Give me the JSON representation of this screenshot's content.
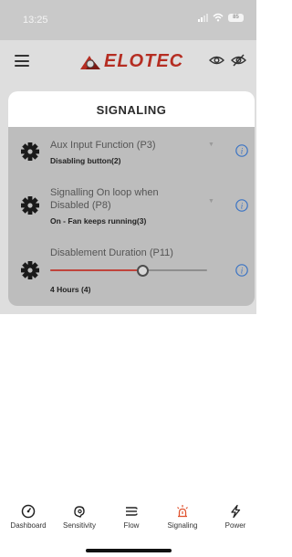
{
  "status_bar": {
    "time": "13:25",
    "battery": "85"
  },
  "header": {
    "brand": "ELOTEC"
  },
  "card": {
    "title": "SIGNALING"
  },
  "settings": [
    {
      "title": "Aux Input Function (P3)",
      "value": "Disabling button(2)"
    },
    {
      "title": "Signalling On loop when Disabled (P8)",
      "value": "On - Fan keeps running(3)"
    },
    {
      "title": "Disablement Duration (P11)",
      "value": "4 Hours (4)",
      "slider_fraction": 0.59
    }
  ],
  "nav": {
    "items": [
      {
        "label": "Dashboard",
        "icon": "gauge-icon"
      },
      {
        "label": "Sensitivity",
        "icon": "sensitivity-icon"
      },
      {
        "label": "Flow",
        "icon": "flow-icon"
      },
      {
        "label": "Signaling",
        "icon": "siren-icon",
        "active": true
      },
      {
        "label": "Power",
        "icon": "lightning-icon"
      }
    ]
  },
  "colors": {
    "brand_red": "#b52d22",
    "info_blue": "#3a73c4",
    "active_nav": "#e0532e",
    "card_bg": "#bdbdbd",
    "header_bg": "#dedede"
  }
}
